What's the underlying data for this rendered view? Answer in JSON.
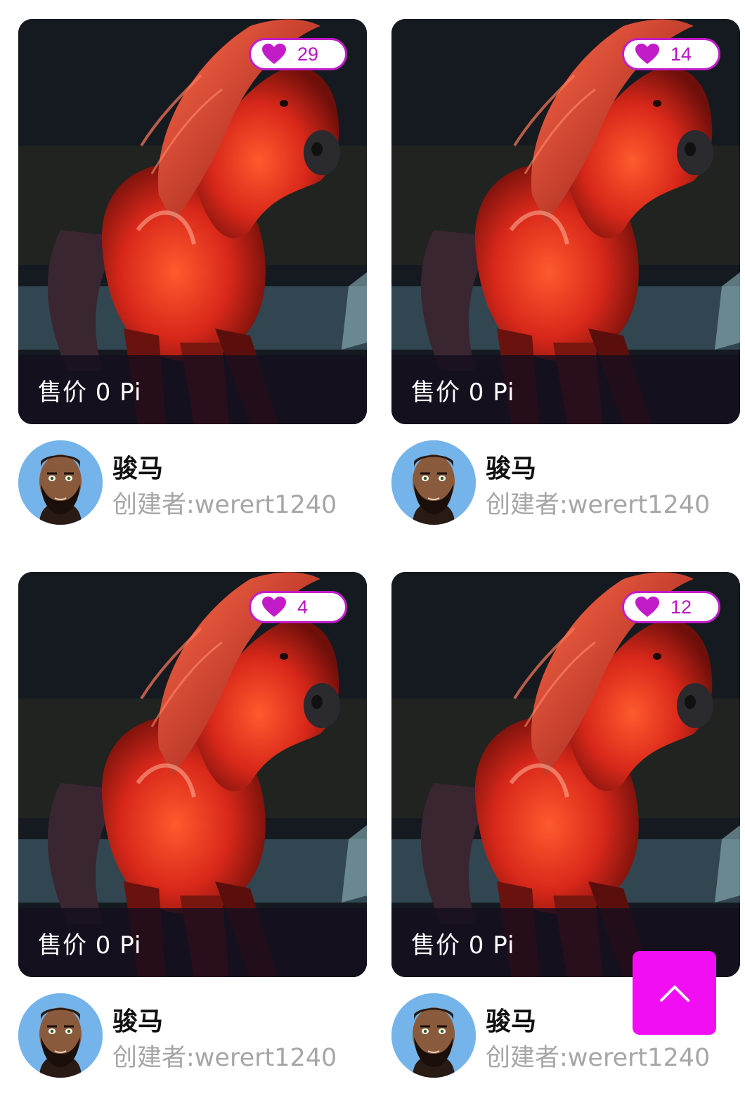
{
  "cards": [
    {
      "likes": "29",
      "price": "售价 0 Pi",
      "title": "骏马",
      "creator": "创建者:werert1240"
    },
    {
      "likes": "14",
      "price": "售价 0 Pi",
      "title": "骏马",
      "creator": "创建者:werert1240"
    },
    {
      "likes": "4",
      "price": "售价 0 Pi",
      "title": "骏马",
      "creator": "创建者:werert1240"
    },
    {
      "likes": "12",
      "price": "售价 0 Pi",
      "title": "骏马",
      "creator": "创建者:werert1240"
    }
  ],
  "icons": {
    "like": "heart-icon",
    "scroll_top": "chevron-up-icon",
    "artwork": "red-horse-artwork",
    "avatar": "bearded-man-avatar"
  },
  "colors": {
    "accent_magenta": "#f10ef3",
    "like_badge": "#c21cc9",
    "creator_text": "#a6a6a6"
  }
}
